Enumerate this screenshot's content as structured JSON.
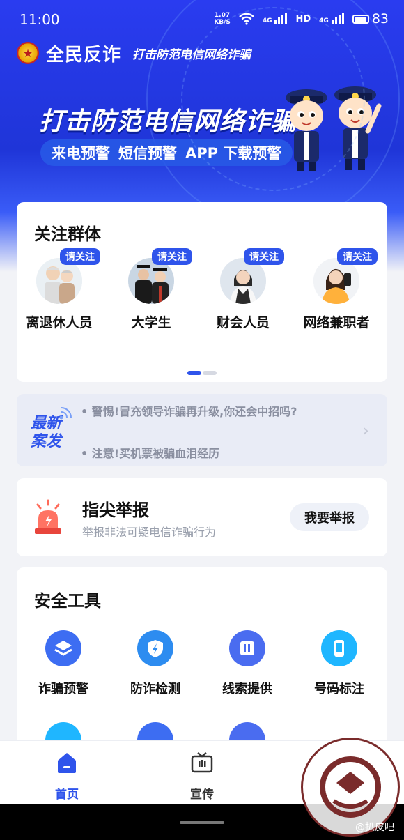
{
  "status_bar": {
    "time": "11:00",
    "speed_top": "1.07",
    "speed_unit": "KB/S",
    "network_a": "4G",
    "hd": "HD",
    "network_b": "4G",
    "battery": "83"
  },
  "header": {
    "app_name": "全民反诈",
    "slogan": "打击防范电信网络诈骗"
  },
  "banner": {
    "title": "打击防范电信网络诈骗",
    "pill_items": [
      "来电预警",
      "短信预警",
      "APP 下载预警"
    ]
  },
  "groups": {
    "title": "关注群体",
    "tag": "请关注",
    "items": [
      {
        "label": "离退休人员",
        "icon": "elderly-couple-avatar"
      },
      {
        "label": "大学生",
        "icon": "graduates-avatar"
      },
      {
        "label": "财会人员",
        "icon": "accountant-avatar"
      },
      {
        "label": "网络兼职者",
        "icon": "phone-user-avatar"
      }
    ]
  },
  "news": {
    "badge_line1": "最新",
    "badge_line2": "案发",
    "items": [
      "• 警惕!冒充领导诈骗再升级,你还会中招吗?",
      "• 注意!买机票被骗血泪经历"
    ]
  },
  "report": {
    "title": "指尖举报",
    "subtitle": "举报非法可疑电信诈骗行为",
    "button": "我要举报"
  },
  "tools": {
    "title": "安全工具",
    "items": [
      {
        "label": "诈骗预警",
        "icon": "layers-icon",
        "color": "#3d6df2"
      },
      {
        "label": "防诈检测",
        "icon": "shield-bolt-icon",
        "color": "#2d8cf0"
      },
      {
        "label": "线索提供",
        "icon": "clue-icon",
        "color": "#4a6cf0"
      },
      {
        "label": "号码标注",
        "icon": "phone-icon",
        "color": "#1fb6ff"
      }
    ]
  },
  "nav": {
    "items": [
      {
        "label": "首页",
        "icon": "home-icon",
        "active": true
      },
      {
        "label": "宣传",
        "icon": "tv-icon",
        "active": false
      }
    ],
    "active_color": "#2f54eb"
  },
  "watermark": {
    "text": "@扒皮吧"
  }
}
